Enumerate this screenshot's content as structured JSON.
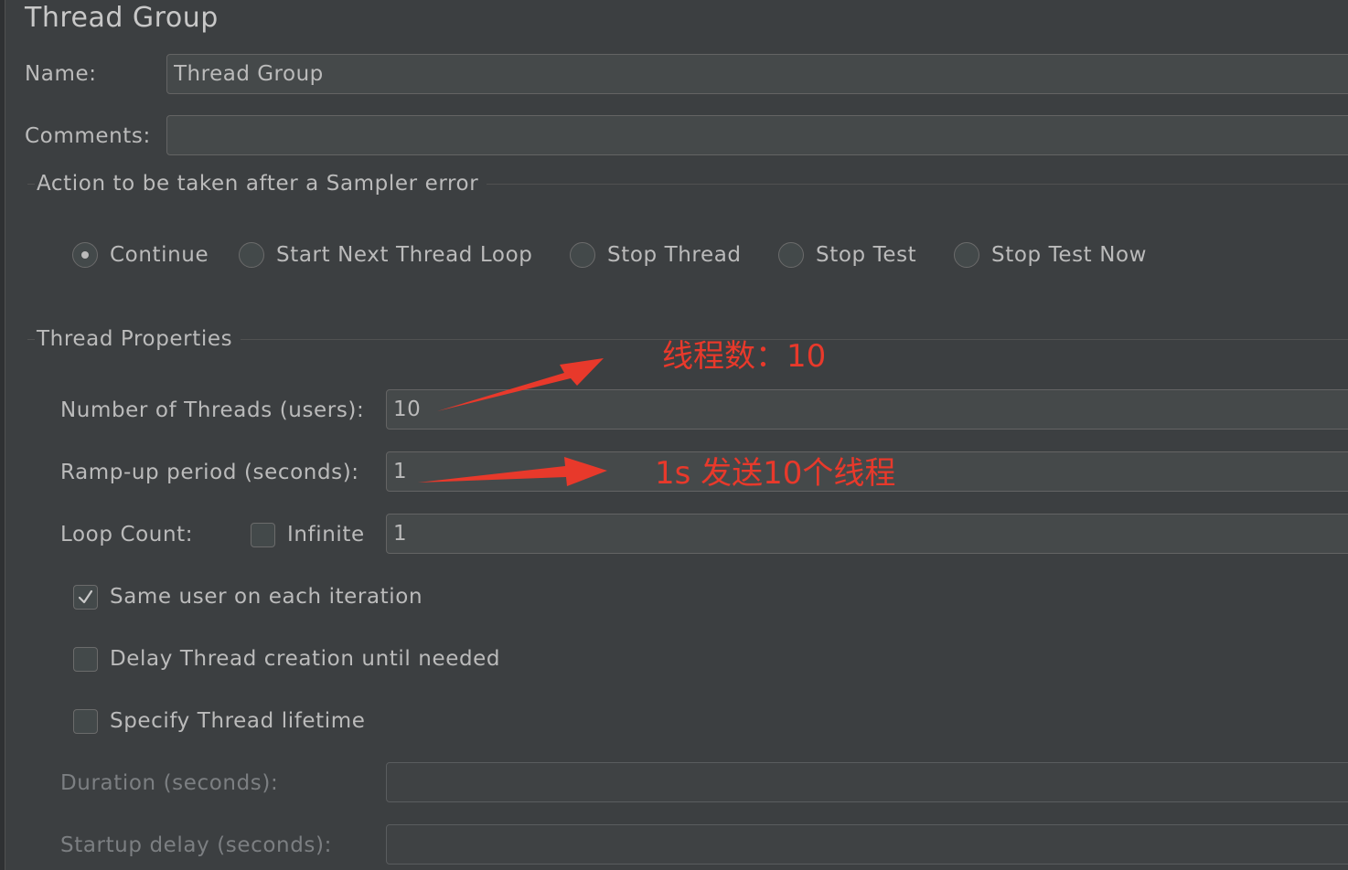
{
  "panel": {
    "title": "Thread Group"
  },
  "name_label": "Name:",
  "name_value": "Thread Group",
  "comments_label": "Comments:",
  "comments_value": "",
  "sampler_error": {
    "title": "Action to be taken after a Sampler error",
    "options": [
      "Continue",
      "Start Next Thread Loop",
      "Stop Thread",
      "Stop Test",
      "Stop Test Now"
    ],
    "selected": "Continue"
  },
  "thread_properties": {
    "title": "Thread Properties",
    "num_threads_label": "Number of Threads (users):",
    "num_threads_value": "10",
    "ramp_up_label": "Ramp-up period (seconds):",
    "ramp_up_value": "1",
    "loop_count_label": "Loop Count:",
    "infinite_label": "Infinite",
    "infinite_checked": false,
    "loop_count_value": "1",
    "same_user_label": "Same user on each iteration",
    "same_user_checked": true,
    "delay_creation_label": "Delay Thread creation until needed",
    "delay_creation_checked": false,
    "specify_lifetime_label": "Specify Thread lifetime",
    "specify_lifetime_checked": false,
    "duration_label": "Duration (seconds):",
    "duration_value": "",
    "startup_delay_label": "Startup delay (seconds):",
    "startup_delay_value": ""
  },
  "annotations": {
    "threads_note": "线程数：10",
    "ramp_note": "1s 发送10个线程",
    "color": "#e8392b"
  }
}
